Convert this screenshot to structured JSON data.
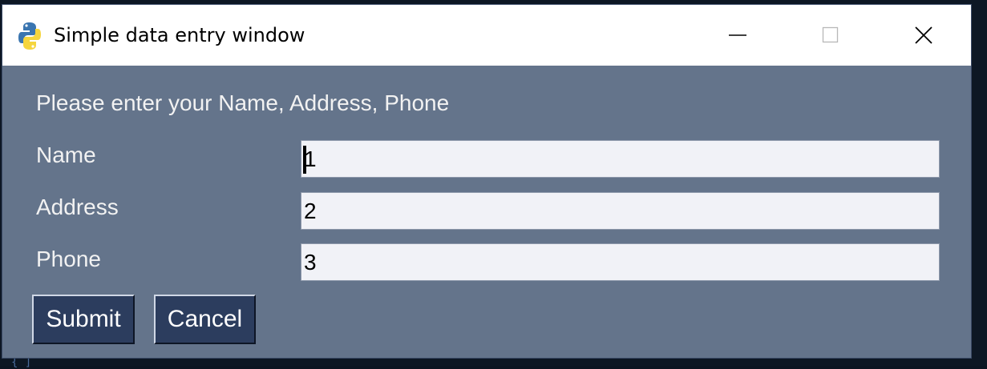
{
  "window": {
    "title": "Simple data entry window",
    "app_icon": "python-icon",
    "controls": {
      "minimize": "minimize-icon",
      "maximize": "maximize-icon",
      "close": "close-icon"
    }
  },
  "form": {
    "prompt": "Please enter your Name, Address, Phone",
    "fields": [
      {
        "label": "Name",
        "value": "1"
      },
      {
        "label": "Address",
        "value": "2"
      },
      {
        "label": "Phone",
        "value": "3"
      }
    ],
    "buttons": {
      "submit": "Submit",
      "cancel": "Cancel"
    }
  },
  "background": {
    "glyph": "{ ]"
  },
  "colors": {
    "window_bg": "#64748b",
    "input_bg": "#f1f2f7",
    "button_bg": "#2c3d5e",
    "text": "#f2f2f2"
  }
}
